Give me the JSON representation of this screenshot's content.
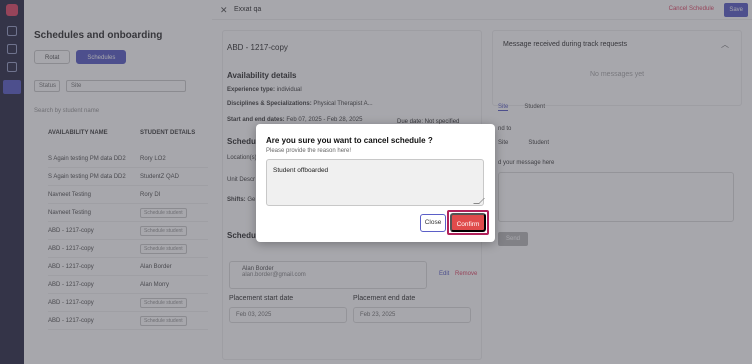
{
  "background": {
    "title": "Schedules and onboarding",
    "tabs": [
      "Rotat",
      "Schedules"
    ],
    "filters": [
      "Status",
      "Site"
    ],
    "search_placeholder": "Search by student name",
    "columns": [
      "AVAILABILITY NAME",
      "STUDENT DETAILS"
    ],
    "rows": [
      {
        "name": "S Again testing PM data DD2",
        "student": "Rory LO2",
        "pill": false
      },
      {
        "name": "S Again testing PM data DD2",
        "student": "StudentZ QAD",
        "pill": false
      },
      {
        "name": "Navneet Testing",
        "student": "Rory DI",
        "pill": false
      },
      {
        "name": "Navneet Testing",
        "student": "Schedule student",
        "pill": true
      },
      {
        "name": "ABD - 1217-copy",
        "student": "Schedule student",
        "pill": true
      },
      {
        "name": "ABD - 1217-copy",
        "student": "Schedule student",
        "pill": true
      },
      {
        "name": "ABD - 1217-copy",
        "student": "Alan Border",
        "pill": false
      },
      {
        "name": "ABD - 1217-copy",
        "student": "Alan Morry",
        "pill": false
      },
      {
        "name": "ABD - 1217-copy",
        "student": "Schedule student",
        "pill": true
      },
      {
        "name": "ABD - 1217-copy",
        "student": "Schedule student",
        "pill": true
      }
    ]
  },
  "panel": {
    "title": "Exxat qa",
    "cancel_schedule": "Cancel Schedule",
    "save": "Save",
    "name": "ABD - 1217-copy",
    "availability_heading": "Availability details",
    "experience_label": "Experience type:",
    "experience_value": "individual",
    "disciplines_label": "Disciplines & Specializations:",
    "disciplines_value": "Physical Therapist A...",
    "dates_label": "Start and end dates:",
    "dates_value": "Feb 07, 2025 - Feb 28, 2025",
    "due_date": "Due date: Not specified",
    "schedule_heading": "Schedule",
    "location_label": "Location(s)",
    "unit_label": "Unit Descr",
    "shifts_label": "Shifts:",
    "shifts_value": "Ge",
    "schedule_heading_2": "Schedule",
    "person_name": "Alan Border",
    "person_email": "alan.border@gmail.com",
    "edit": "Edit",
    "remove": "Remove",
    "placement_start_label": "Placement start date",
    "placement_start_value": "Feb 03, 2025",
    "placement_end_label": "Placement end date",
    "placement_end_value": "Feb 23, 2025",
    "messages_title": "Message received during track requests",
    "no_messages": "No messages yet",
    "right_tabs": [
      "Site",
      "Student"
    ],
    "send_to": "nd to",
    "send_options": [
      "Site",
      "Student"
    ],
    "add_message": "d your message here",
    "send_button": "Send"
  },
  "modal": {
    "title": "Are you sure you want to cancel schedule ?",
    "subtitle": "Please provide the reason here!",
    "reason_value": "Student offboarded",
    "close_label": "Close",
    "confirm_label": "Confirm"
  }
}
